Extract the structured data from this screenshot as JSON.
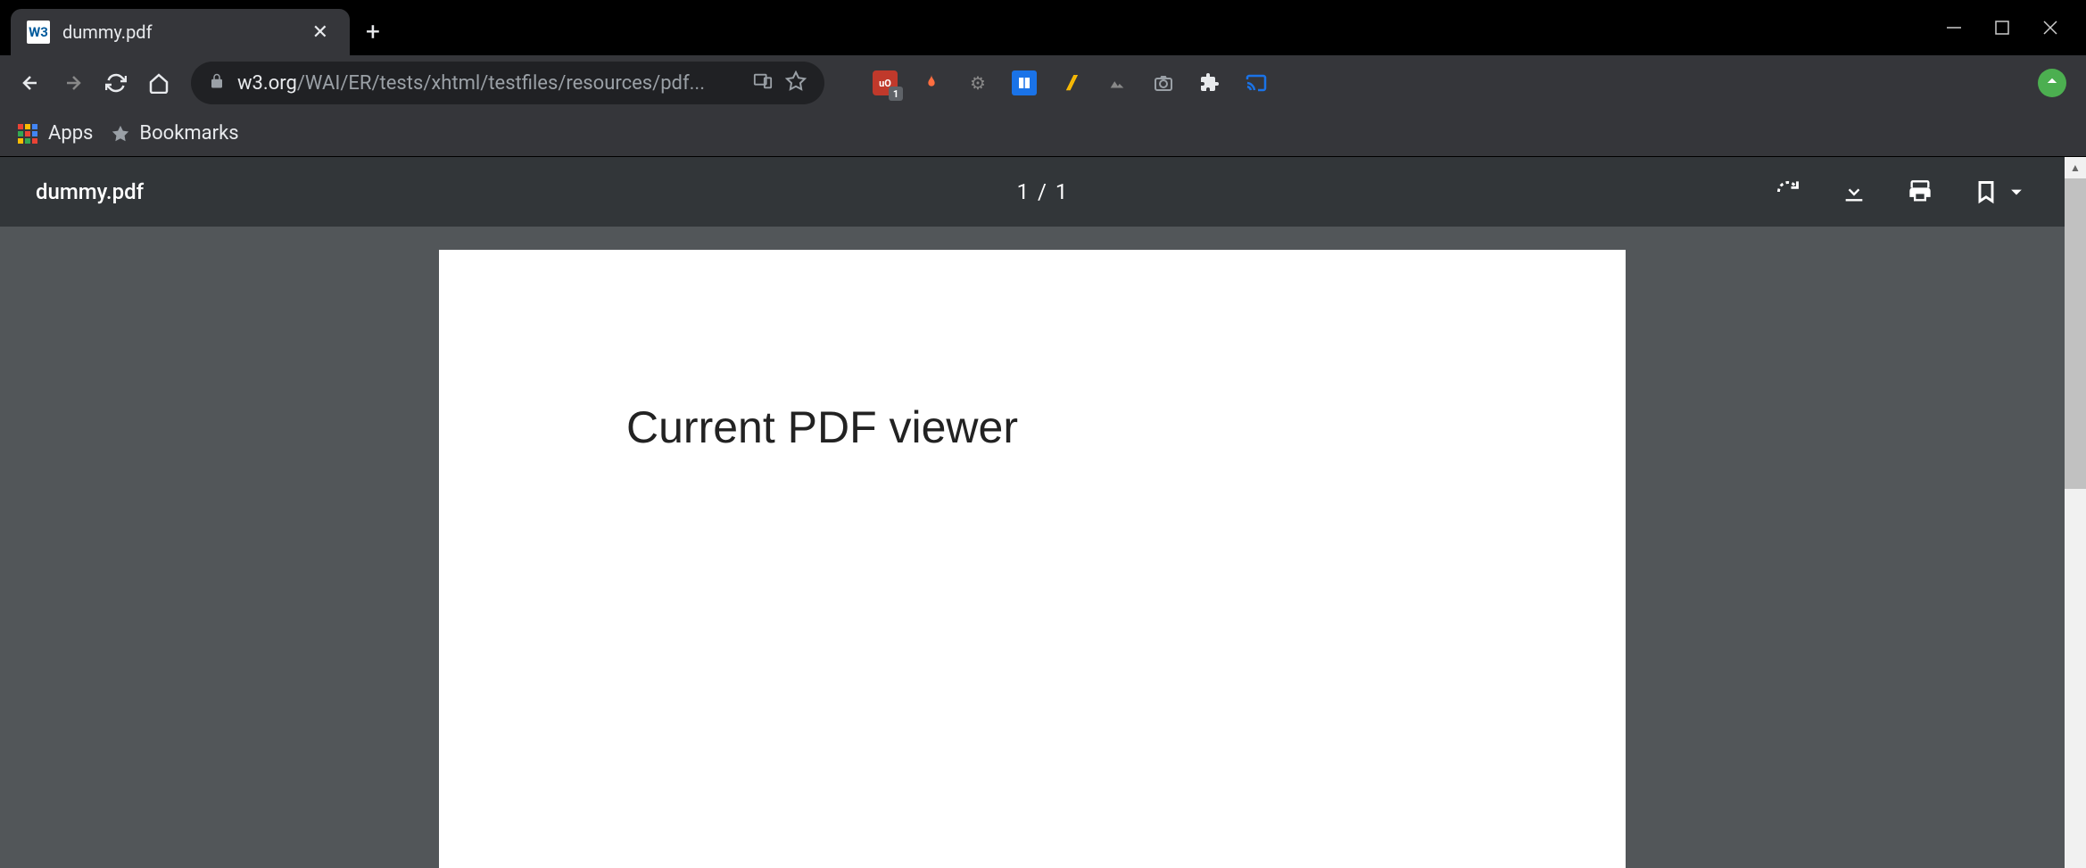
{
  "window": {
    "tab_title": "dummy.pdf",
    "favicon_text": "W3"
  },
  "toolbar": {
    "url_domain": "w3.org",
    "url_path": "/WAI/ER/tests/xhtml/testfiles/resources/pdf...",
    "extension_badge": "1"
  },
  "bookmarks": {
    "apps_label": "Apps",
    "bookmarks_label": "Bookmarks"
  },
  "pdf": {
    "filename": "dummy.pdf",
    "page_indicator": "1 / 1",
    "content_text": "Current PDF viewer"
  }
}
